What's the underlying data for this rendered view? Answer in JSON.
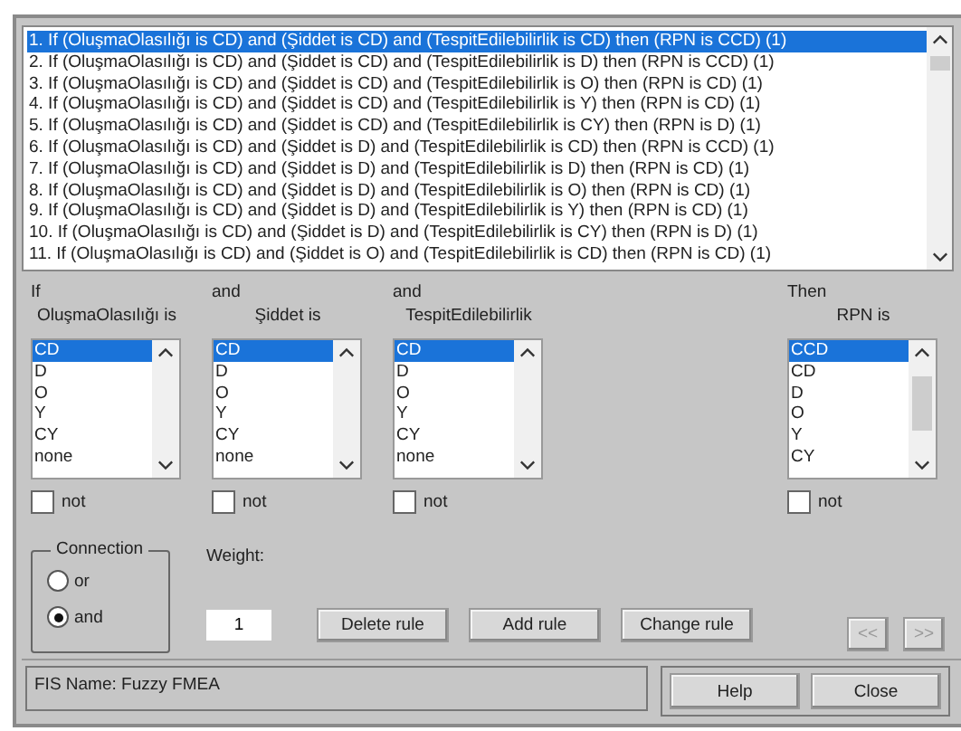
{
  "rules": [
    {
      "text": "1. If (OluşmaOlasılığı is CD) and (Şiddet is CD) and (TespitEdilebilirlik is CD) then (RPN is CCD) (1)",
      "selected": true
    },
    {
      "text": "2. If (OluşmaOlasılığı is CD) and (Şiddet is CD) and (TespitEdilebilirlik is D) then (RPN is CCD) (1)",
      "selected": false
    },
    {
      "text": "3. If (OluşmaOlasılığı is CD) and (Şiddet is CD) and (TespitEdilebilirlik is O) then (RPN is CD) (1)",
      "selected": false
    },
    {
      "text": "4. If (OluşmaOlasılığı is CD) and (Şiddet is CD) and (TespitEdilebilirlik is Y) then (RPN is CD) (1)",
      "selected": false
    },
    {
      "text": "5. If (OluşmaOlasılığı is CD) and (Şiddet is CD) and (TespitEdilebilirlik is CY) then (RPN is D) (1)",
      "selected": false
    },
    {
      "text": "6. If (OluşmaOlasılığı is CD) and (Şiddet is D) and (TespitEdilebilirlik is CD) then (RPN is CCD) (1)",
      "selected": false
    },
    {
      "text": "7. If (OluşmaOlasılığı is CD) and (Şiddet is D) and (TespitEdilebilirlik is D) then (RPN is CD) (1)",
      "selected": false
    },
    {
      "text": "8. If (OluşmaOlasılığı is CD) and (Şiddet is D) and (TespitEdilebilirlik is O) then (RPN is CD) (1)",
      "selected": false
    },
    {
      "text": "9. If (OluşmaOlasılığı is CD) and (Şiddet is D) and (TespitEdilebilirlik is Y) then (RPN is CD) (1)",
      "selected": false
    },
    {
      "text": "10. If (OluşmaOlasılığı is CD) and (Şiddet is D) and (TespitEdilebilirlik is CY) then (RPN is D) (1)",
      "selected": false
    },
    {
      "text": "11. If (OluşmaOlasılığı is CD) and (Şiddet is O) and (TespitEdilebilirlik is CD) then (RPN is CD) (1)",
      "selected": false
    }
  ],
  "inputs": [
    {
      "connector": "If",
      "label": "OluşmaOlasılığı is",
      "not": false,
      "not_label": "not",
      "items": [
        {
          "label": "CD",
          "selected": true
        },
        {
          "label": "D",
          "selected": false
        },
        {
          "label": "O",
          "selected": false
        },
        {
          "label": "Y",
          "selected": false
        },
        {
          "label": "CY",
          "selected": false
        },
        {
          "label": "none",
          "selected": false
        }
      ]
    },
    {
      "connector": "and",
      "label": "Şiddet is",
      "not": false,
      "not_label": "not",
      "items": [
        {
          "label": "CD",
          "selected": true
        },
        {
          "label": "D",
          "selected": false
        },
        {
          "label": "O",
          "selected": false
        },
        {
          "label": "Y",
          "selected": false
        },
        {
          "label": "CY",
          "selected": false
        },
        {
          "label": "none",
          "selected": false
        }
      ]
    },
    {
      "connector": "and",
      "label": "TespitEdilebilirlik",
      "not": false,
      "not_label": "not",
      "items": [
        {
          "label": "CD",
          "selected": true
        },
        {
          "label": "D",
          "selected": false
        },
        {
          "label": "O",
          "selected": false
        },
        {
          "label": "Y",
          "selected": false
        },
        {
          "label": "CY",
          "selected": false
        },
        {
          "label": "none",
          "selected": false
        }
      ]
    }
  ],
  "output": {
    "connector": "Then",
    "label": "RPN is",
    "not": false,
    "not_label": "not",
    "items": [
      {
        "label": "CCD",
        "selected": true
      },
      {
        "label": "CD",
        "selected": false
      },
      {
        "label": "D",
        "selected": false
      },
      {
        "label": "O",
        "selected": false
      },
      {
        "label": "Y",
        "selected": false
      },
      {
        "label": "CY",
        "selected": false
      }
    ]
  },
  "connection": {
    "label": "Connection",
    "options": [
      {
        "label": "or",
        "selected": false
      },
      {
        "label": "and",
        "selected": true
      }
    ]
  },
  "weight": {
    "label": "Weight:",
    "value": "1"
  },
  "buttons": [
    {
      "label": "Delete rule",
      "disabled": false
    },
    {
      "label": "Add rule",
      "disabled": false
    },
    {
      "label": "Change rule",
      "disabled": false
    }
  ],
  "nav_buttons": [
    {
      "label": "<<",
      "disabled": true
    },
    {
      "label": ">>",
      "disabled": true
    }
  ],
  "fis_name": "FIS Name: Fuzzy FMEA",
  "footer_buttons": [
    "Help",
    "Close"
  ]
}
